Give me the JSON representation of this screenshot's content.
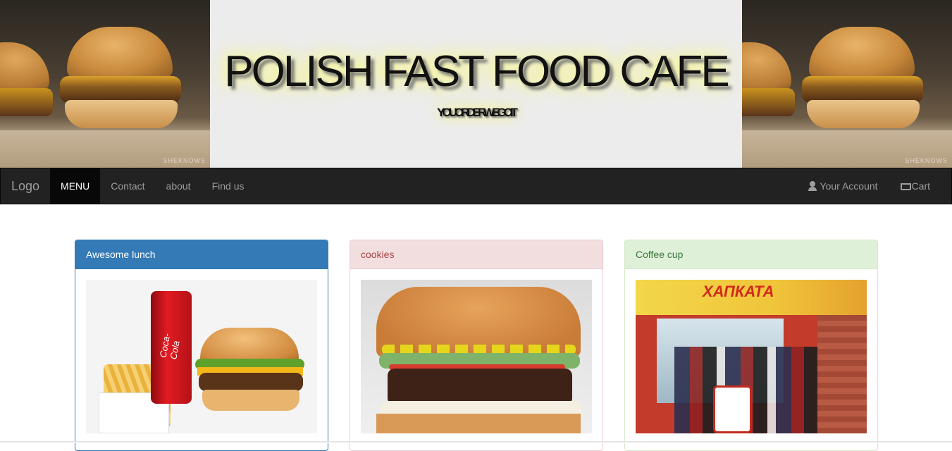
{
  "header": {
    "title": "POLISH FAST FOOD CAFE",
    "subtitle": "YOUORDERWEGOIT",
    "watermark": "SHEKNOWS"
  },
  "navbar": {
    "brand": "Logo",
    "items": [
      {
        "label": "MENU",
        "active": true
      },
      {
        "label": "Contact",
        "active": false
      },
      {
        "label": "about",
        "active": false
      },
      {
        "label": "Find us",
        "active": false
      }
    ],
    "right": [
      {
        "label": "Your Account",
        "icon": "user-icon"
      },
      {
        "label": "Cart",
        "icon": "cart-icon"
      }
    ]
  },
  "panels": [
    {
      "heading": "Awesome lunch",
      "style": "primary",
      "color": "#337ab7"
    },
    {
      "heading": "cookies",
      "style": "danger",
      "color": "#f2dede"
    },
    {
      "heading": "Coffee cup",
      "style": "success",
      "color": "#dff0d8"
    }
  ],
  "images": {
    "can_text": "Coca-Cola",
    "store_sign": "ХАПКАТА"
  }
}
